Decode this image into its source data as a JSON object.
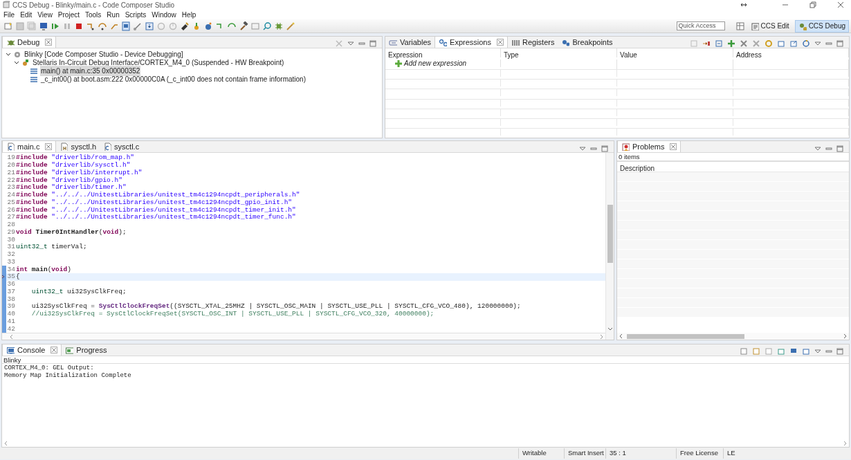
{
  "window": {
    "title": "CCS Debug - Blinky/main.c - Code Composer Studio"
  },
  "menu": [
    "File",
    "Edit",
    "View",
    "Project",
    "Tools",
    "Run",
    "Scripts",
    "Window",
    "Help"
  ],
  "toolbar": {
    "quick_access": {
      "placeholder": "Quick Access"
    },
    "perspectives": [
      {
        "label": "CCS Edit",
        "selected": false
      },
      {
        "label": "CCS Debug",
        "selected": true
      }
    ]
  },
  "debug_view": {
    "tabs": [
      {
        "label": "Debug",
        "selected": true
      }
    ],
    "tree": [
      {
        "label": "Blinky [Code Composer Studio - Device Debugging]",
        "kind": "session",
        "expanded": true,
        "children": [
          {
            "label": "Stellaris In-Circuit Debug Interface/CORTEX_M4_0 (Suspended - HW Breakpoint)",
            "kind": "thread",
            "expanded": true,
            "children": [
              {
                "label": "main() at main.c:35 0x00000352",
                "kind": "frame",
                "selected": true
              },
              {
                "label": "_c_int00() at boot.asm:222 0x00000C0A  (_c_int00 does not contain frame information)",
                "kind": "frame",
                "selected": false
              }
            ]
          }
        ]
      }
    ]
  },
  "expressions_view": {
    "tabs": [
      {
        "label": "Variables",
        "selected": false
      },
      {
        "label": "Expressions",
        "selected": true
      },
      {
        "label": "Registers",
        "selected": false
      },
      {
        "label": "Breakpoints",
        "selected": false
      }
    ],
    "columns": [
      "Expression",
      "Type",
      "Value",
      "Address"
    ],
    "add_row": "Add new expression"
  },
  "editor": {
    "tabs": [
      {
        "label": "main.c",
        "selected": true
      },
      {
        "label": "sysctl.h",
        "selected": false
      },
      {
        "label": "sysctl.c",
        "selected": false
      }
    ],
    "lines": [
      {
        "number": "19",
        "current": false,
        "range": false,
        "segments": [
          {
            "kind": "directive",
            "text": "#include"
          },
          {
            "kind": "string",
            "text": " \"driverlib/rom_map.h\""
          }
        ]
      },
      {
        "number": "20",
        "current": false,
        "range": false,
        "segments": [
          {
            "kind": "directive",
            "text": "#include"
          },
          {
            "kind": "string",
            "text": " \"driverlib/sysctl.h\""
          }
        ]
      },
      {
        "number": "21",
        "current": false,
        "range": false,
        "segments": [
          {
            "kind": "directive",
            "text": "#include"
          },
          {
            "kind": "string",
            "text": " \"driverlib/interrupt.h\""
          }
        ]
      },
      {
        "number": "22",
        "current": false,
        "range": false,
        "segments": [
          {
            "kind": "directive",
            "text": "#include"
          },
          {
            "kind": "string",
            "text": " \"driverlib/gpio.h\""
          }
        ]
      },
      {
        "number": "23",
        "current": false,
        "range": false,
        "segments": [
          {
            "kind": "directive",
            "text": "#include"
          },
          {
            "kind": "string",
            "text": " \"driverlib/timer.h\""
          }
        ]
      },
      {
        "number": "24",
        "current": false,
        "range": false,
        "segments": [
          {
            "kind": "directive",
            "text": "#include"
          },
          {
            "kind": "string",
            "text": " \"../../../UnitestLibraries/unitest_tm4c1294ncpdt_peripherals.h\""
          }
        ]
      },
      {
        "number": "25",
        "current": false,
        "range": false,
        "segments": [
          {
            "kind": "directive",
            "text": "#include"
          },
          {
            "kind": "string",
            "text": " \"../../../UnitestLibraries/unitest_tm4c1294ncpdt_gpio_init.h\""
          }
        ]
      },
      {
        "number": "26",
        "current": false,
        "range": false,
        "segments": [
          {
            "kind": "directive",
            "text": "#include"
          },
          {
            "kind": "string",
            "text": " \"../../../UnitestLibraries/unitest_tm4c1294ncpdt_timer_init.h\""
          }
        ]
      },
      {
        "number": "27",
        "current": false,
        "range": false,
        "segments": [
          {
            "kind": "directive",
            "text": "#include"
          },
          {
            "kind": "string",
            "text": " \"../../../UnitestLibraries/unitest_tm4c1294ncpdt_timer_func.h\""
          }
        ]
      },
      {
        "number": "28",
        "current": false,
        "range": false
      },
      {
        "number": "29",
        "current": false,
        "range": false,
        "segments": [
          {
            "kind": "keyword",
            "text": "void"
          },
          {
            "kind": "function",
            "text": " Timer0IntHandler"
          },
          {
            "kind": "plain",
            "text": "("
          },
          {
            "kind": "keyword",
            "text": "void"
          },
          {
            "kind": "plain",
            "text": ");"
          }
        ]
      },
      {
        "number": "30",
        "current": false,
        "range": false
      },
      {
        "number": "31",
        "current": false,
        "range": false,
        "segments": [
          {
            "kind": "type",
            "text": "uint32_t"
          },
          {
            "kind": "plain",
            "text": " timerVal;"
          }
        ]
      },
      {
        "number": "32",
        "current": false,
        "range": false
      },
      {
        "number": "33",
        "current": false,
        "range": false
      },
      {
        "number": "34",
        "current": false,
        "range": true,
        "segments": [
          {
            "kind": "keyword",
            "text": "int"
          },
          {
            "kind": "function",
            "text": " main"
          },
          {
            "kind": "plain",
            "text": "("
          },
          {
            "kind": "keyword",
            "text": "void"
          },
          {
            "kind": "plain",
            "text": ")"
          }
        ]
      },
      {
        "number": "35",
        "current": true,
        "range": true,
        "segments": [
          {
            "kind": "plain",
            "text": "{"
          }
        ]
      },
      {
        "number": "36",
        "current": false,
        "range": true
      },
      {
        "number": "37",
        "current": false,
        "range": true,
        "segments": [
          {
            "kind": "type",
            "text": "    uint32_t"
          },
          {
            "kind": "plain",
            "text": " ui32SysClkFreq;"
          }
        ]
      },
      {
        "number": "38",
        "current": false,
        "range": true
      },
      {
        "number": "39",
        "current": false,
        "range": true,
        "segments": [
          {
            "kind": "plain",
            "text": "    ui32SysClkFreq = "
          },
          {
            "kind": "call",
            "text": "SysCtlClockFreqSet"
          },
          {
            "kind": "plain",
            "text": "((SYSCTL_XTAL_25MHZ | SYSCTL_OSC_MAIN | SYSCTL_USE_PLL | SYSCTL_CFG_VCO_480), 120000000);"
          }
        ]
      },
      {
        "number": "40",
        "current": false,
        "range": true,
        "segments": [
          {
            "kind": "comment",
            "text": "    //ui32SysClkFreq = SysCtlClockFreqSet(SYSCTL_OSC_INT | SYSCTL_USE_PLL | SYSCTL_CFG_VCO_320, 40000000);"
          }
        ]
      },
      {
        "number": "41",
        "current": false,
        "range": true
      },
      {
        "number": "42",
        "current": false,
        "range": true
      }
    ]
  },
  "problems_view": {
    "tabs": [
      {
        "label": "Problems",
        "selected": true
      }
    ],
    "summary": "0 items",
    "columns": [
      "Description"
    ]
  },
  "console_view": {
    "tabs": [
      {
        "label": "Console",
        "selected": true
      },
      {
        "label": "Progress",
        "selected": false
      }
    ],
    "name": "Blinky",
    "output": [
      "CORTEX_M4_0: GEL Output:",
      "Memory Map Initialization Complete"
    ]
  },
  "status_bar": [
    "Writable",
    "Smart Insert",
    "35 : 1",
    "Free License",
    "LE"
  ]
}
